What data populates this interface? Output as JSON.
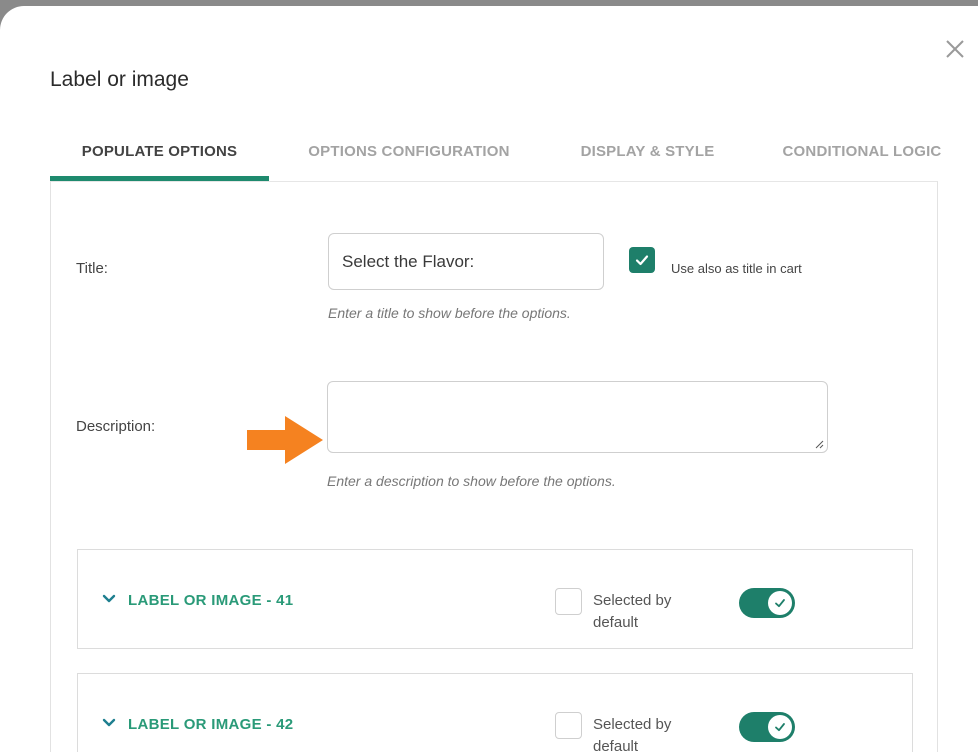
{
  "modal": {
    "title": "Label or image"
  },
  "tabs": [
    {
      "label": "POPULATE OPTIONS",
      "active": true
    },
    {
      "label": "OPTIONS CONFIGURATION",
      "active": false
    },
    {
      "label": "DISPLAY & STYLE",
      "active": false
    },
    {
      "label": "CONDITIONAL LOGIC",
      "active": false
    }
  ],
  "title_field": {
    "label": "Title:",
    "value": "Select the Flavor:",
    "hint": "Enter a title to show before the options.",
    "cart_checkbox_label": "Use also as title in cart",
    "cart_checkbox_checked": true
  },
  "description_field": {
    "label": "Description:",
    "value": "",
    "hint": "Enter a description to show before the options."
  },
  "options": [
    {
      "title": "LABEL OR IMAGE - 41",
      "selected_label": "Selected by default",
      "selected": false,
      "enabled": true
    },
    {
      "title": "LABEL OR IMAGE - 42",
      "selected_label": "Selected by default",
      "selected": false,
      "enabled": true
    }
  ],
  "colors": {
    "accent": "#1e8a6e",
    "option_title": "#2a9a78",
    "arrow": "#f58220"
  }
}
